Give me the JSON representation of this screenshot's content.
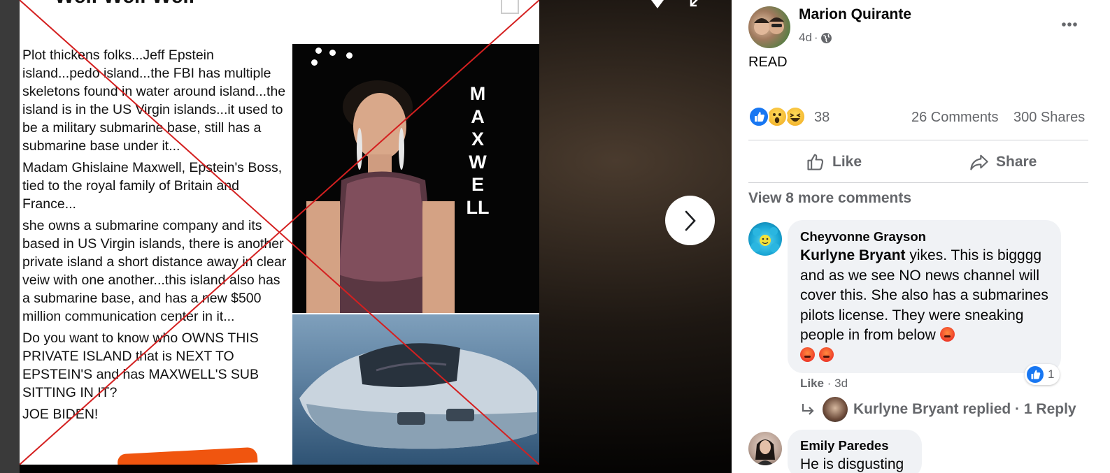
{
  "media": {
    "heading": "Well Well Well",
    "paragraphs": [
      "Plot thickens folks...Jeff Epstein island...pedo island...the FBI has multiple skeletons found in water around island...the island is in the US Virgin islands...it used to be a military submarine base, still has a submarine base under it...",
      "Madam Ghislaine Maxwell, Epstein's Boss, tied to the royal family of Britain and France...",
      "she owns a submarine company and its based in US Virgin islands, there is another private island a short distance away in clear veiw with one another...this island also has a submarine base, and has a new $500 million communication center in it...",
      "Do you want to know who OWNS THIS PRIVATE ISLAND that is NEXT TO EPSTEIN'S and has MAXWELL'S SUB SITTING IN IT?",
      "JOE BIDEN!"
    ],
    "photo_label": "MAXWELL",
    "cross_color": "#d42020",
    "next_icon": "chevron-right-icon"
  },
  "post": {
    "author": "Marion Quirante",
    "time": "4d",
    "separator": "·",
    "audience_icon": "globe-icon",
    "text": "READ",
    "reaction_icons": [
      "like-icon",
      "wow-icon",
      "haha-icon"
    ],
    "reaction_count": "38",
    "comments_count": "26 Comments",
    "shares_count": "300 Shares",
    "like_label": "Like",
    "share_label": "Share",
    "view_more": "View 8 more comments"
  },
  "comments": [
    {
      "name": "Cheyvonne Grayson",
      "mention": "Kurlyne Bryant",
      "text": " yikes. This is bigggg and as we see NO news channel will cover this. She also has a submarines pilots license. They were sneaking people in from below ",
      "like_count": "1",
      "like_label": "Like",
      "time": "· 3d",
      "reply_text": "Kurlyne Bryant replied · 1 Reply"
    },
    {
      "name": "Emily Paredes",
      "text": "He is disgusting"
    }
  ],
  "colors": {
    "accent": "#1877f2",
    "secondary_text": "#65676b",
    "bubble": "#f0f2f5"
  }
}
